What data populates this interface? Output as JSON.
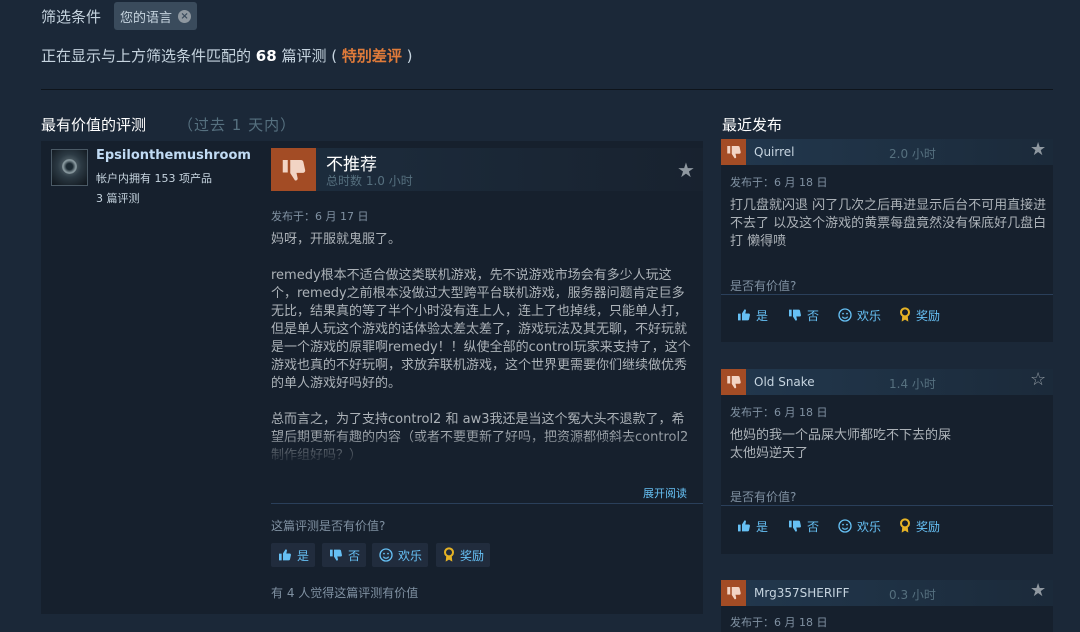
{
  "filter": {
    "label": "筛选条件",
    "chip_label": "您的语言",
    "chip_close": "×"
  },
  "showing": {
    "prefix": "正在显示与上方筛选条件匹配的",
    "count": "68",
    "suffix": "篇评测 (",
    "tag": "特别差评",
    "close": ")"
  },
  "main_section": {
    "title": "最有价值的评测",
    "subtitle": "（过去 1 天内）"
  },
  "recent_section": {
    "title": "最近发布"
  },
  "main_review": {
    "author": "Epsilonthemushroom",
    "owned": "帐户内拥有 153 项产品",
    "reviews": "3 篇评测",
    "verdict": "不推荐",
    "hours": "总时数 1.0 小时",
    "posted": "发布于：6 月 17 日",
    "paragraphs": [
      "妈呀，开服就鬼服了。",
      "remedy根本不适合做这类联机游戏，先不说游戏市场会有多少人玩这个，remedy之前根本没做过大型跨平台联机游戏，服务器问题肯定巨多无比，结果真的等了半个小时没有连上人，连上了也掉线，只能单人打，但是单人玩这个游戏的话体验太差太差了，游戏玩法及其无聊，不好玩就是一个游戏的原罪啊remedy！！纵使全部的control玩家来支持了，这个游戏也真的不好玩啊，求放弃联机游戏，这个世界更需要你们继续做优秀的单人游戏好吗好的。",
      "总而言之，为了支持control2 和 aw3我还是当这个冤大头不退款了，希望后期更新有趣的内容（或者不要更新了好吗，把资源都倾斜去control2制作组好吗？）"
    ],
    "read_more": "展开阅读",
    "helpful_question": "这篇评测是否有价值?",
    "buttons": {
      "yes": "是",
      "no": "否",
      "funny": "欢乐",
      "award": "奖励"
    },
    "found_helpful": "有 4 人觉得这篇评测有价值"
  },
  "recent_reviews": [
    {
      "name": "Quirrel",
      "hours": "2.0 小时",
      "starred": true,
      "posted": "发布于：6 月 18 日",
      "lines": [
        "打几盘就闪退 闪了几次之后再进显示后台不可用直接进不去了 以及这个游戏的黄票每盘竟然没有保底好几盘白打 懒得喷"
      ],
      "helpful_question": "是否有价值?",
      "buttons": {
        "yes": "是",
        "no": "否",
        "funny": "欢乐",
        "award": "奖励"
      }
    },
    {
      "name": "Old Snake",
      "hours": "1.4 小时",
      "starred": false,
      "posted": "发布于：6 月 18 日",
      "lines": [
        "他妈的我一个品屎大师都吃不下去的屎",
        "太他妈逆天了"
      ],
      "helpful_question": "是否有价值?",
      "buttons": {
        "yes": "是",
        "no": "否",
        "funny": "欢乐",
        "award": "奖励"
      }
    },
    {
      "name": "Mrg357SHERIFF",
      "hours": "0.3 小时",
      "starred": true,
      "posted": "发布于：6 月 18 日"
    }
  ],
  "colors": {
    "page_bg": "#1b2838",
    "card_bg": "#16202d",
    "thumb_down": "#a34c25",
    "accent_link": "#66c0f4",
    "negative_tag": "#e07b3a",
    "award_gold": "#e6b325"
  }
}
